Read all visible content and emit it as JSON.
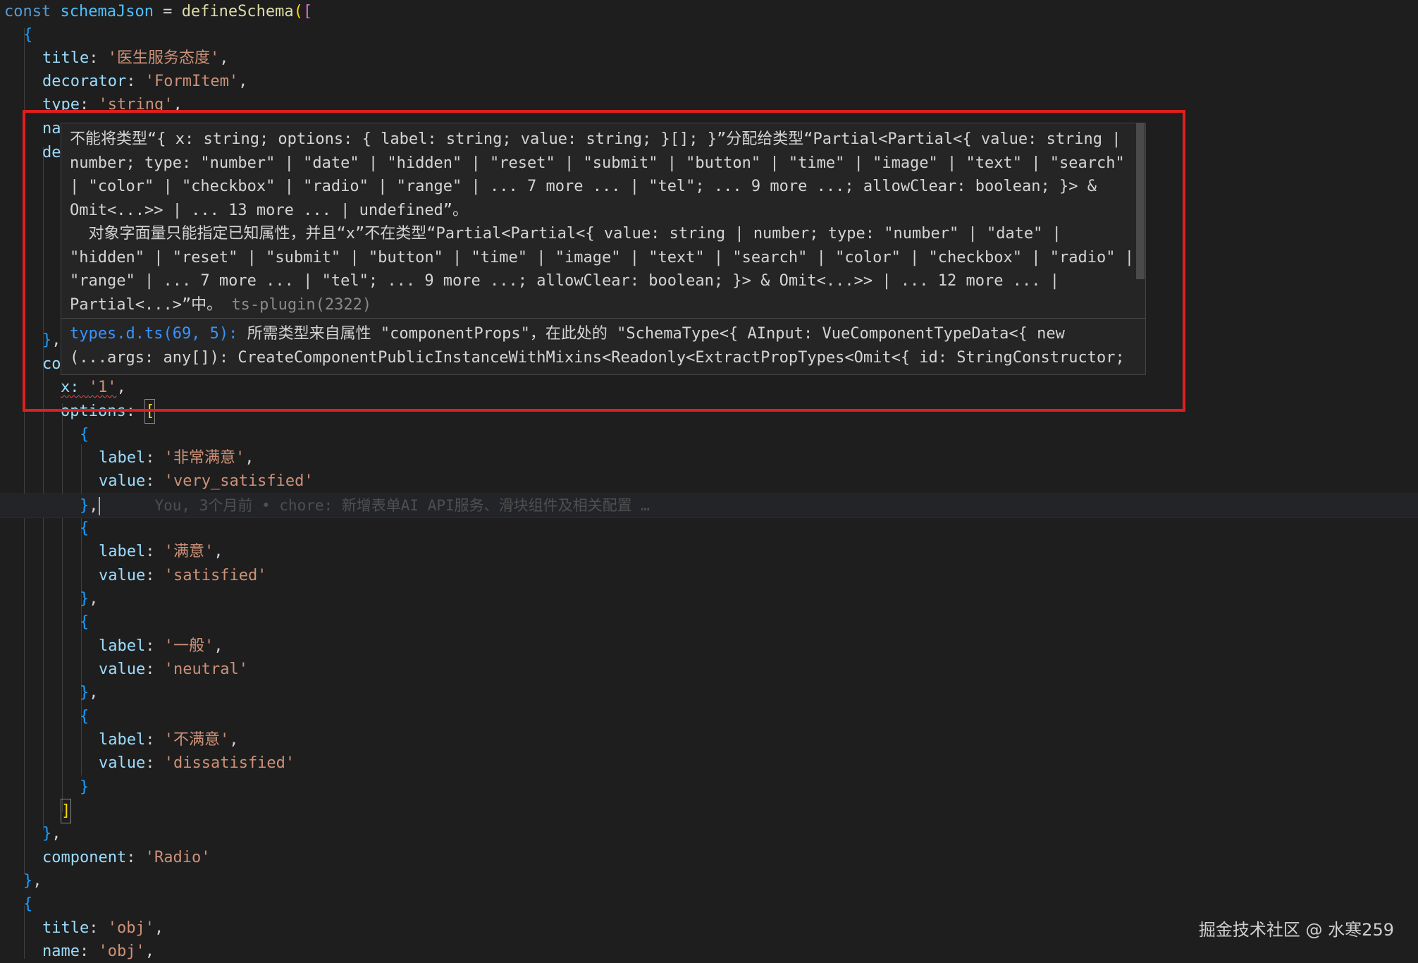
{
  "code": {
    "l1": {
      "kw": "const",
      "name": "schemaJson",
      "eq": " = ",
      "fn": "defineSchema",
      "open": "(["
    },
    "l2": "{",
    "title_key": "title",
    "title_val": "'医生服务态度'",
    "decorator_key": "decorator",
    "decorator_val": "'FormItem'",
    "type_key": "type",
    "type_val": "'string'",
    "na_frag": "na",
    "de_frag": "de",
    "close_obj": "},",
    "co_frag": "co",
    "x_key": "x",
    "x_val": "'1'",
    "options_key": "options",
    "options_open": "[",
    "opt_open": "{",
    "opt_close": "},",
    "opt_last_close": "}",
    "options_close": "]",
    "label_key": "label",
    "value_key": "value",
    "options": [
      {
        "label": "'非常满意'",
        "value": "'very_satisfied'"
      },
      {
        "label": "'满意'",
        "value": "'satisfied'"
      },
      {
        "label": "'一般'",
        "value": "'neutral'"
      },
      {
        "label": "'不满意'",
        "value": "'dissatisfied'"
      }
    ],
    "blame": "You, 3个月前 • chore: 新增表单AI API服务、滑块组件及相关配置 …",
    "component_key": "component",
    "component_val": "'Radio'",
    "item_close": "},",
    "obj_title_key": "title",
    "obj_title_val": "'obj'",
    "obj_name_key": "name",
    "obj_name_val": "'obj'"
  },
  "hover": {
    "message": "不能将类型“{ x: string; options: { label: string; value: string; }[]; }”分配给类型“Partial<Partial<{ value: string | number; type: \"number\" | \"date\" | \"hidden\" | \"reset\" | \"submit\" | \"button\" | \"time\" | \"image\" | \"text\" | \"search\" | \"color\" | \"checkbox\" | \"radio\" | \"range\" | ... 7 more ... | \"tel\"; ... 9 more ...; allowClear: boolean; }> & Omit<...>> | ... 13 more ... | undefined”。\n  对象字面量只能指定已知属性，并且“x”不在类型“Partial<Partial<{ value: string | number; type: \"number\" | \"date\" | \"hidden\" | \"reset\" | \"submit\" | \"button\" | \"time\" | \"image\" | \"text\" | \"search\" | \"color\" | \"checkbox\" | \"radio\" | \"range\" | ... 7 more ... | \"tel\"; ... 9 more ...; allowClear: boolean; }> & Omit<...>> | ... 12 more ... | Partial<...>”中。",
    "source": "ts-plugin(2322)",
    "related_link": "types.d.ts(69, 5):",
    "related_text": " 所需类型来自属性 \"componentProps\"，在此处的 \"SchemaType<{ AInput: VueComponentTypeData<{ new (...args: any[]): CreateComponentPublicInstanceWithMixins<Readonly<ExtractPropTypes<Omit<{ id: StringConstructor;"
  },
  "watermark": "掘金技术社区 @ 水寒259",
  "colors": {
    "highlight": "#e01e1e",
    "error_squiggle": "#f14c4c",
    "link": "#3794ff"
  }
}
